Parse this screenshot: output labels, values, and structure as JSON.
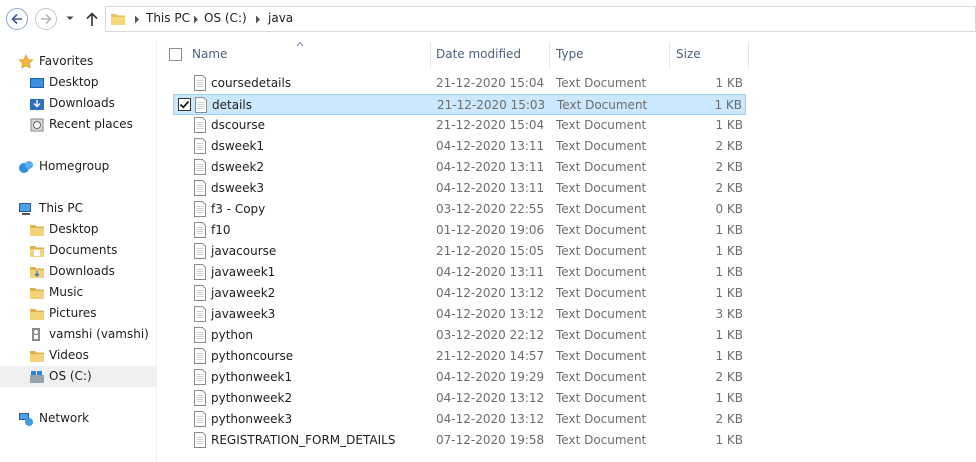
{
  "address": {
    "crumbs": [
      "This PC",
      "OS (C:)",
      "java"
    ]
  },
  "nav": {
    "favorites": "Favorites",
    "fav_items": [
      "Desktop",
      "Downloads",
      "Recent places"
    ],
    "homegroup": "Homegroup",
    "thispc": "This PC",
    "pc_items": [
      "Desktop",
      "Documents",
      "Downloads",
      "Music",
      "Pictures",
      "vamshi (vamshi)",
      "Videos",
      "OS (C:)"
    ],
    "network": "Network"
  },
  "columns": {
    "name": "Name",
    "date": "Date modified",
    "type": "Type",
    "size": "Size"
  },
  "files": [
    {
      "name": "coursedetails",
      "date": "21-12-2020 15:04",
      "type": "Text Document",
      "size": "1 KB",
      "selected": false
    },
    {
      "name": "details",
      "date": "21-12-2020 15:03",
      "type": "Text Document",
      "size": "1 KB",
      "selected": true
    },
    {
      "name": "dscourse",
      "date": "21-12-2020 15:04",
      "type": "Text Document",
      "size": "1 KB",
      "selected": false
    },
    {
      "name": "dsweek1",
      "date": "04-12-2020 13:11",
      "type": "Text Document",
      "size": "2 KB",
      "selected": false
    },
    {
      "name": "dsweek2",
      "date": "04-12-2020 13:11",
      "type": "Text Document",
      "size": "2 KB",
      "selected": false
    },
    {
      "name": "dsweek3",
      "date": "04-12-2020 13:11",
      "type": "Text Document",
      "size": "2 KB",
      "selected": false
    },
    {
      "name": "f3 - Copy",
      "date": "03-12-2020 22:55",
      "type": "Text Document",
      "size": "0 KB",
      "selected": false
    },
    {
      "name": "f10",
      "date": "01-12-2020 19:06",
      "type": "Text Document",
      "size": "1 KB",
      "selected": false
    },
    {
      "name": "javacourse",
      "date": "21-12-2020 15:05",
      "type": "Text Document",
      "size": "1 KB",
      "selected": false
    },
    {
      "name": "javaweek1",
      "date": "04-12-2020 13:11",
      "type": "Text Document",
      "size": "1 KB",
      "selected": false
    },
    {
      "name": "javaweek2",
      "date": "04-12-2020 13:12",
      "type": "Text Document",
      "size": "1 KB",
      "selected": false
    },
    {
      "name": "javaweek3",
      "date": "04-12-2020 13:12",
      "type": "Text Document",
      "size": "3 KB",
      "selected": false
    },
    {
      "name": "python",
      "date": "03-12-2020 22:12",
      "type": "Text Document",
      "size": "1 KB",
      "selected": false
    },
    {
      "name": "pythoncourse",
      "date": "21-12-2020 14:57",
      "type": "Text Document",
      "size": "1 KB",
      "selected": false
    },
    {
      "name": "pythonweek1",
      "date": "04-12-2020 19:29",
      "type": "Text Document",
      "size": "2 KB",
      "selected": false
    },
    {
      "name": "pythonweek2",
      "date": "04-12-2020 13:12",
      "type": "Text Document",
      "size": "1 KB",
      "selected": false
    },
    {
      "name": "pythonweek3",
      "date": "04-12-2020 13:12",
      "type": "Text Document",
      "size": "2 KB",
      "selected": false
    },
    {
      "name": "REGISTRATION_FORM_DETAILS",
      "date": "07-12-2020 19:58",
      "type": "Text Document",
      "size": "1 KB",
      "selected": false
    }
  ],
  "colors": {
    "selection_bg": "#cce8ff",
    "selection_border": "#99d1ff",
    "header_text": "#4c607a"
  }
}
